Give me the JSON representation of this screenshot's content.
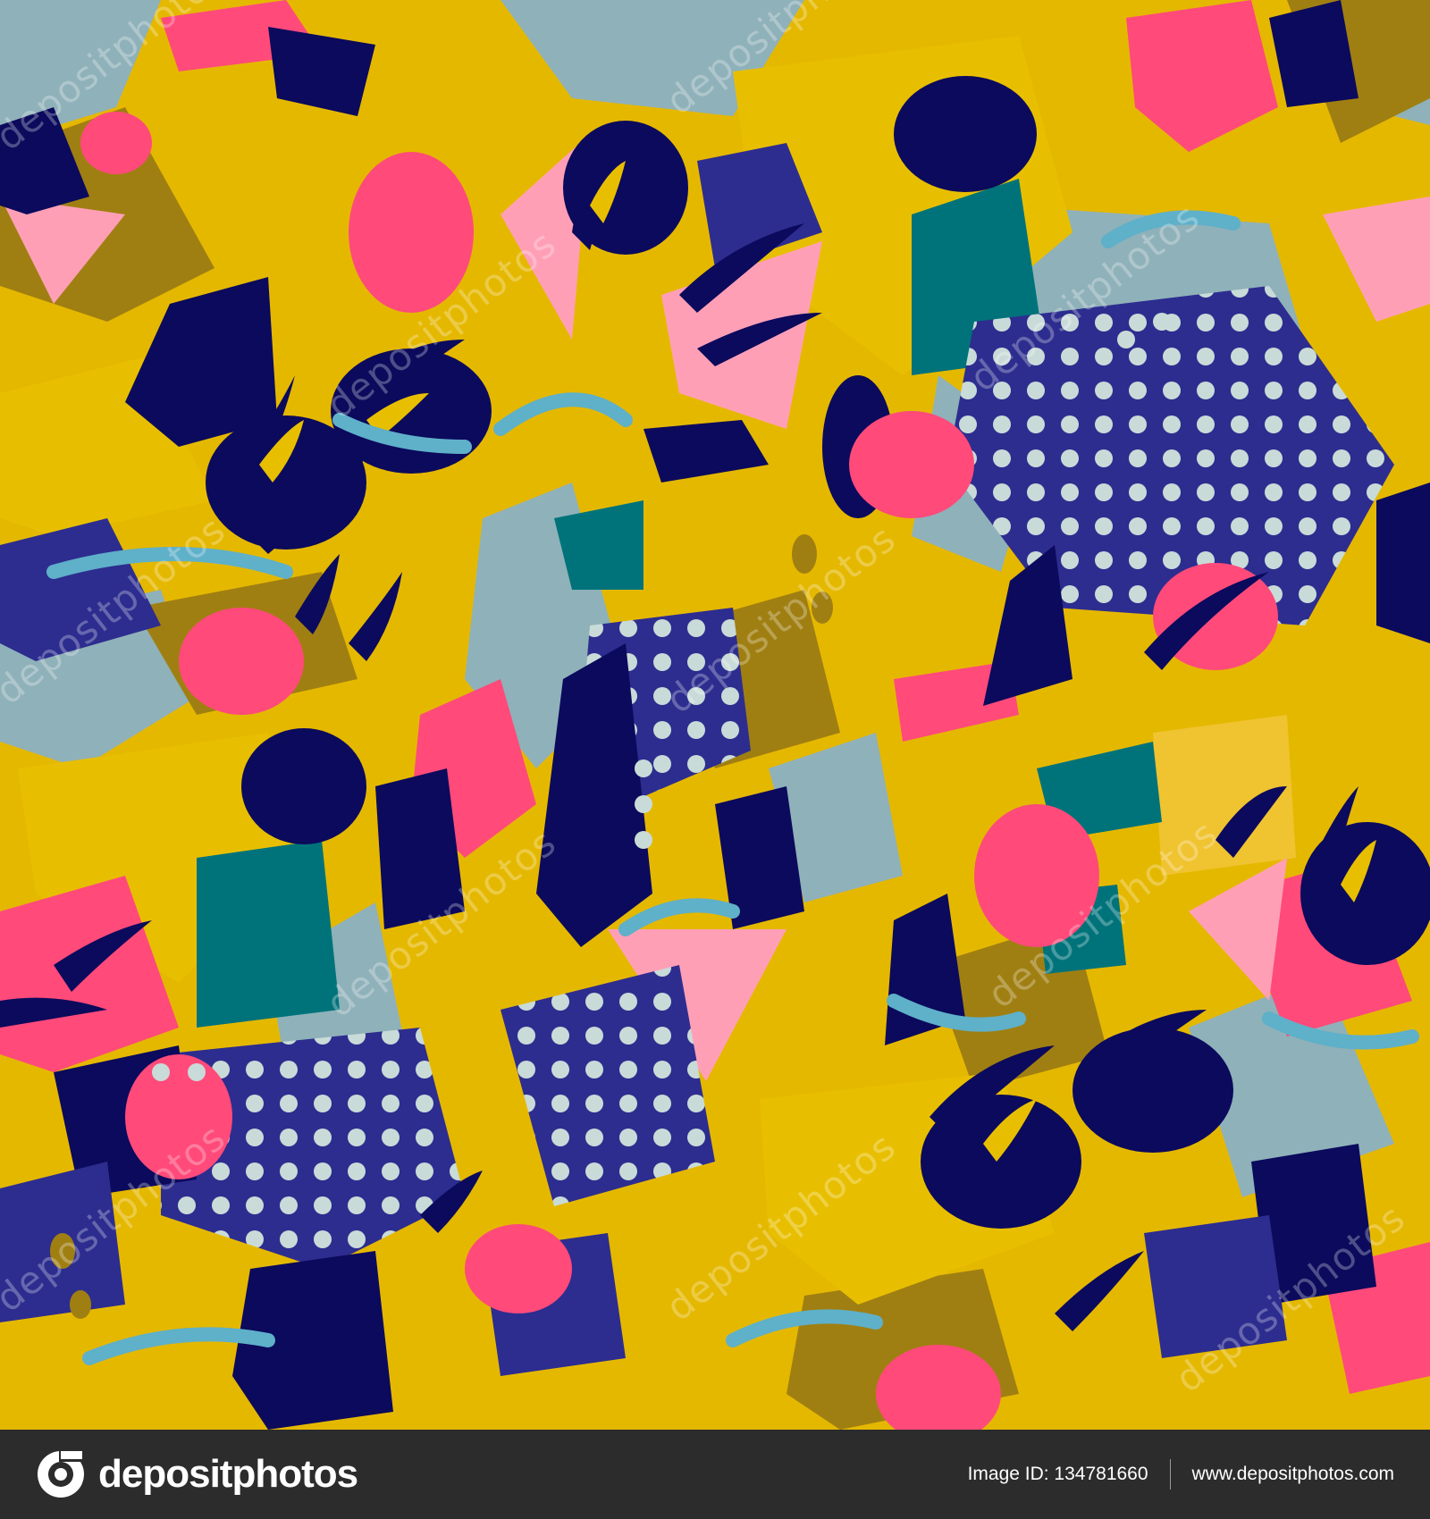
{
  "artwork": {
    "palette": {
      "navy": "#0b0a5c",
      "blue": "#2d2d8f",
      "yellow": "#e5b800",
      "olive": "#a07f12",
      "pink": "#ff4a7a",
      "light_pink": "#ff9fb6",
      "grey_blue": "#8fb1b9",
      "sky": "#5fb0c9",
      "teal": "#00737a",
      "dot": "#c9dbd8"
    },
    "watermark_text": "depositphotos"
  },
  "footer": {
    "brand_name": "depositphotos",
    "image_id_label": "Image ID: 134781660",
    "site_url": "www.depositphotos.com",
    "background_color": "#2c2c2c"
  }
}
